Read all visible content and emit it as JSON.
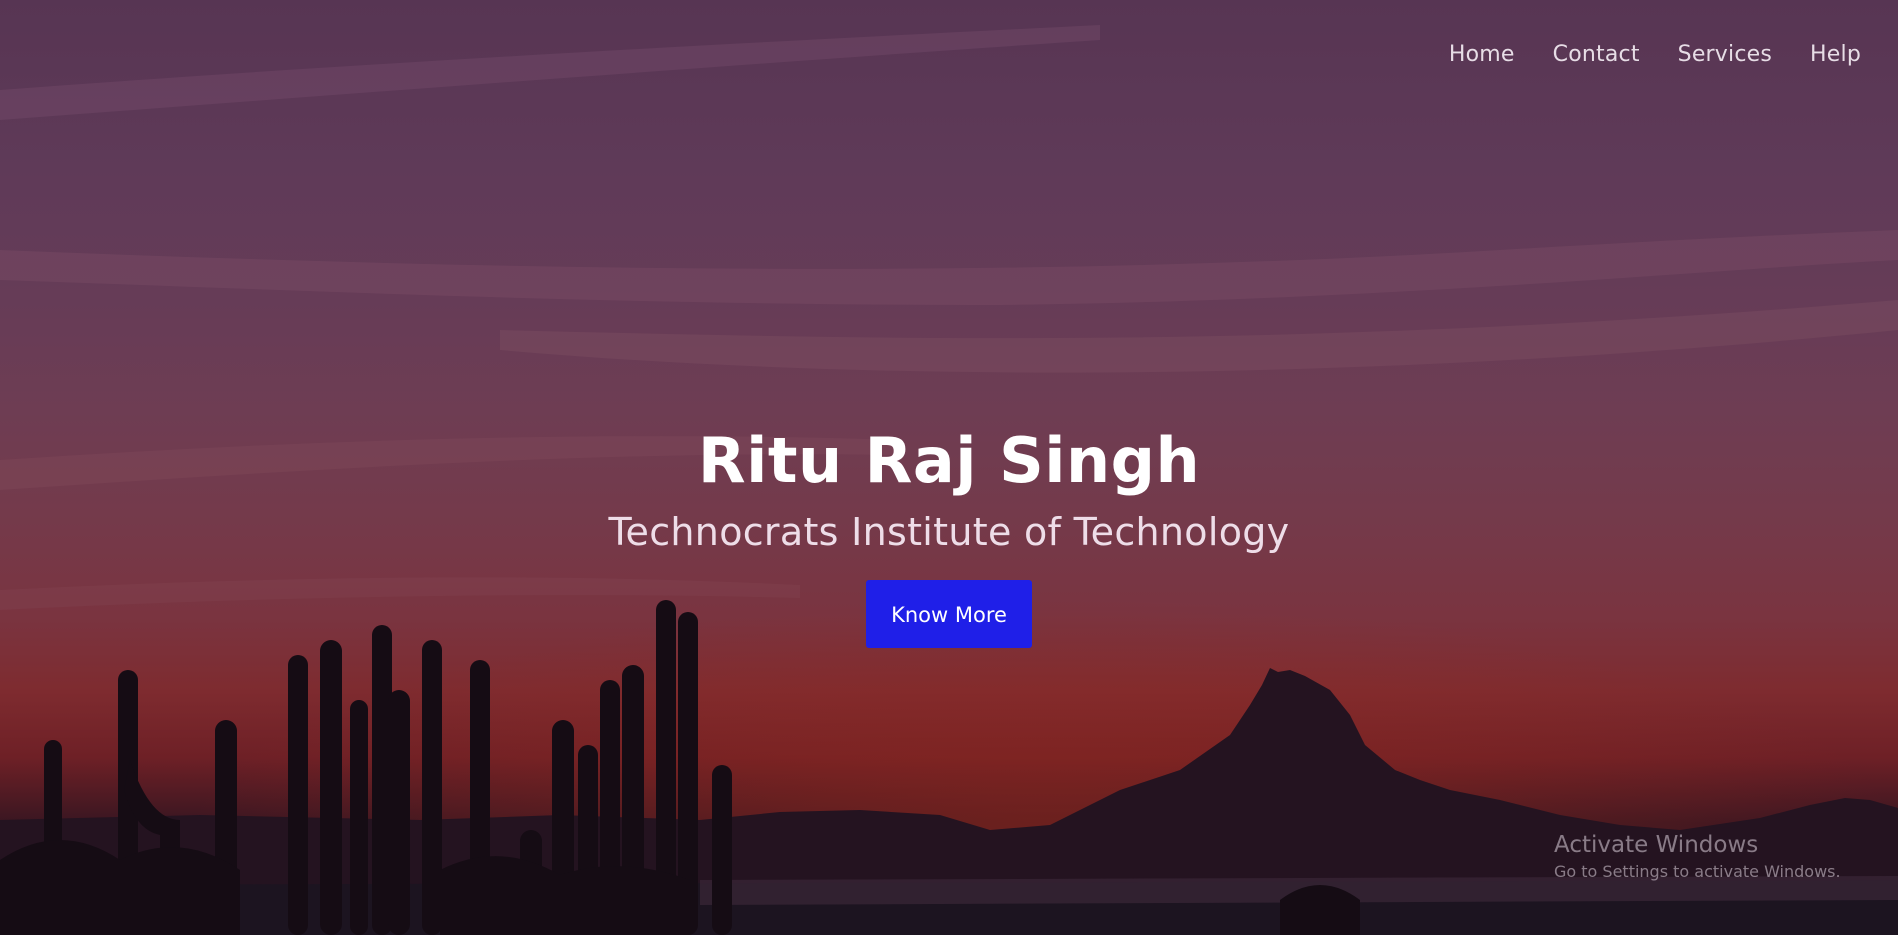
{
  "nav": {
    "items": [
      "Home",
      "Contact",
      "Services",
      "Help"
    ]
  },
  "hero": {
    "name": "Ritu Raj Singh",
    "subtitle": "Technocrats Institute of Technology",
    "button_label": "Know More"
  },
  "watermark": {
    "title": "Activate Windows",
    "subtitle": "Go to Settings to activate Windows."
  },
  "colors": {
    "button": "#1f1fe8",
    "sky_top": "#573553",
    "sky_horizon": "#7e2b2f",
    "silhouette": "#1d0f18"
  }
}
